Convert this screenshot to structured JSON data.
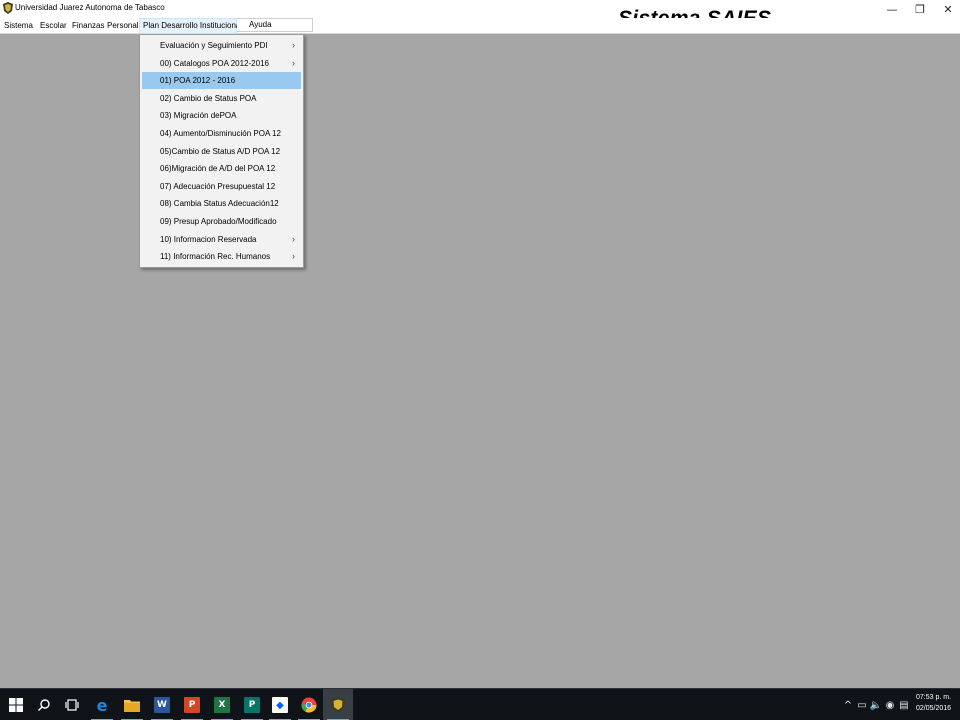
{
  "window": {
    "title": "Universidad Juarez Autonoma de Tabasco",
    "heading": "Sistema SAIES",
    "minimize_glyph": "—",
    "maximize_glyph": "❐",
    "close_glyph": "✕"
  },
  "menubar": {
    "items": [
      "Sistema",
      "Escolar",
      "Finanzas",
      "Personal",
      "Plan Desarrollo Institucional",
      "Ayuda"
    ],
    "open_item": "Plan Desarrollo Institucional"
  },
  "dropdown": {
    "items": [
      {
        "label": "Evaluación y Seguimiento PDI",
        "submenu": true
      },
      {
        "label": "00) Catalogos POA 2012-2016",
        "submenu": true
      },
      {
        "label": "01) POA 2012 - 2016",
        "submenu": false,
        "selected": true
      },
      {
        "label": "02) Cambio de Status POA",
        "submenu": false
      },
      {
        "label": "03) Migración dePOA",
        "submenu": false
      },
      {
        "label": "04) Aumento/Disminución POA 12",
        "submenu": false
      },
      {
        "label": "05)Cambio de Status A/D POA 12",
        "submenu": false
      },
      {
        "label": "06)Migración de A/D del POA 12",
        "submenu": false
      },
      {
        "label": "07) Adecuación Presupuestal 12",
        "submenu": false
      },
      {
        "label": "08) Cambia Status Adecuación12",
        "submenu": false
      },
      {
        "label": "09) Presup Aprobado/Modificado",
        "submenu": false
      },
      {
        "label": "10) Informacion Reservada",
        "submenu": true
      },
      {
        "label": "11) Información Rec. Humanos",
        "submenu": true
      }
    ],
    "submenu_arrow": "›"
  },
  "taskbar": {
    "apps": [
      {
        "icon": "windows-start-icon",
        "glyph": "",
        "color": "#ffffff"
      },
      {
        "icon": "search-icon",
        "glyph": "⌕",
        "color": "#ffffff"
      },
      {
        "icon": "task-view-icon",
        "glyph": "❐",
        "color": "#ffffff"
      },
      {
        "icon": "edge-icon",
        "glyph": "e",
        "color": "#1e88e5"
      },
      {
        "icon": "file-explorer-icon",
        "glyph": "",
        "color": "#f2c14e"
      },
      {
        "icon": "word-icon",
        "glyph": "W",
        "color": "#2b579a"
      },
      {
        "icon": "powerpoint-icon",
        "glyph": "P",
        "color": "#d24726"
      },
      {
        "icon": "excel-icon",
        "glyph": "X",
        "color": "#217346"
      },
      {
        "icon": "publisher-icon",
        "glyph": "P",
        "color": "#077568"
      },
      {
        "icon": "dropbox-icon",
        "glyph": "◆",
        "color": "#0061fe"
      },
      {
        "icon": "chrome-icon",
        "glyph": "",
        "color": "#e8453c"
      },
      {
        "icon": "saies-app-icon",
        "glyph": "",
        "color": "#c9a227"
      }
    ],
    "tray": [
      "^",
      "▭",
      "🔈",
      "◉",
      "▤"
    ],
    "time": "07:53 p. m.",
    "date": "02/05/2016"
  }
}
